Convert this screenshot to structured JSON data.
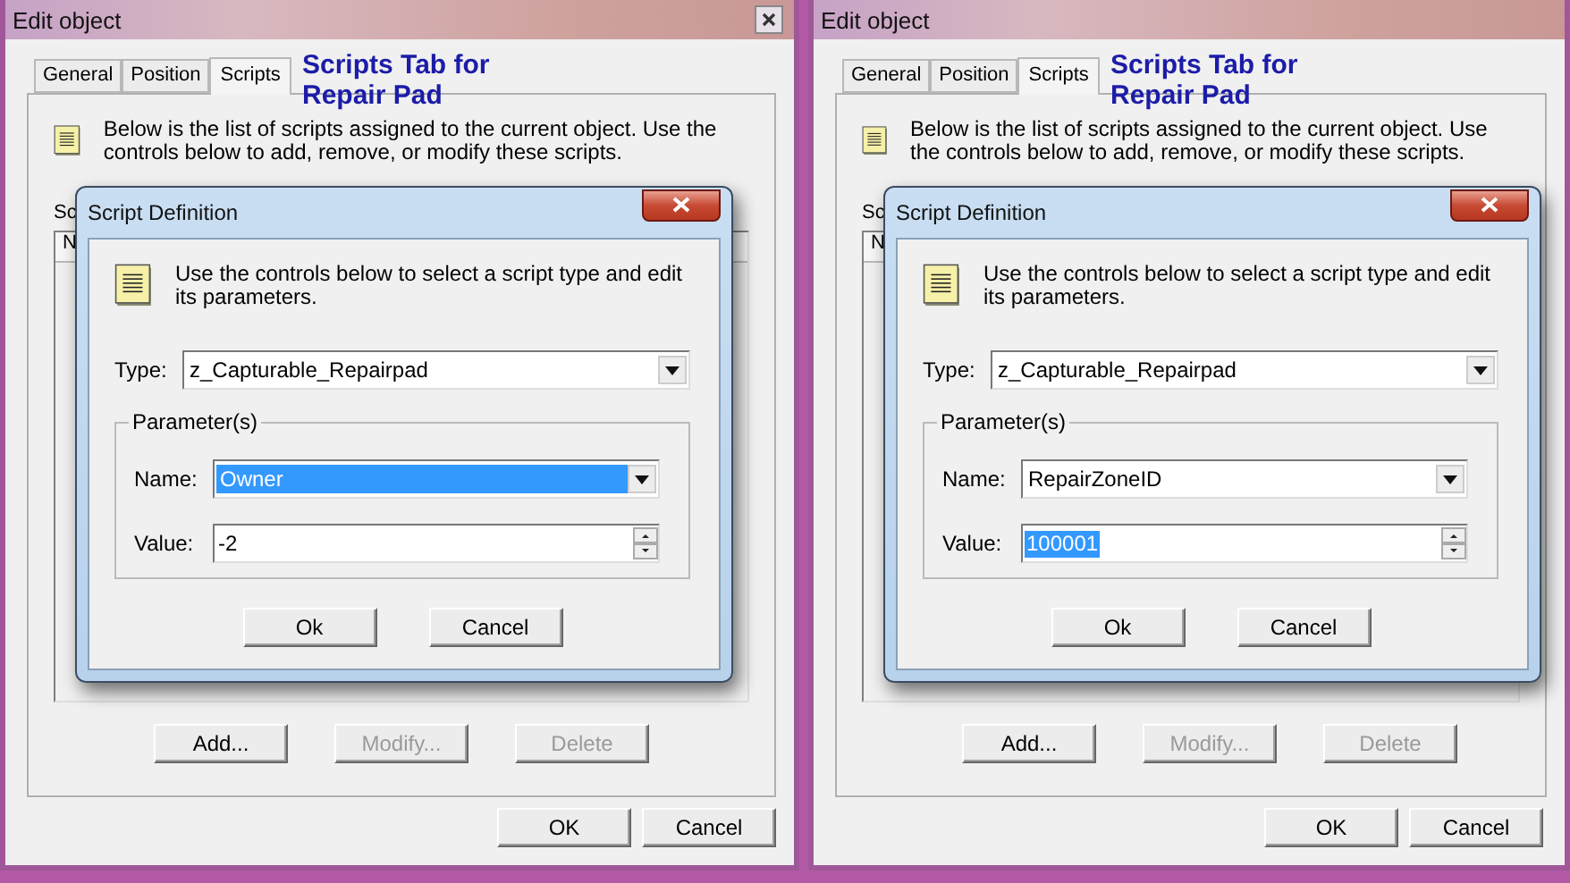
{
  "windows": [
    {
      "title": "Edit object",
      "close_button": true,
      "tabs": [
        {
          "label": "General",
          "selected": false
        },
        {
          "label": "Position",
          "selected": false
        },
        {
          "label": "Scripts",
          "selected": true
        }
      ],
      "annotation": "Scripts Tab for Repair Pad",
      "description": "Below is the list of scripts assigned to the current object.  Use the controls below to add, remove, or modify these scripts.",
      "list_label": "Sc",
      "list_column": "N",
      "buttons": [
        {
          "label": "Add...",
          "disabled": false
        },
        {
          "label": "Modify...",
          "disabled": true
        },
        {
          "label": "Delete",
          "disabled": true
        }
      ],
      "footer_buttons": [
        "OK",
        "Cancel"
      ],
      "dialog": {
        "title": "Script Definition",
        "description": "Use the controls below to select a script type and edit its parameters.",
        "type_label": "Type:",
        "type_value": "z_Capturable_Repairpad",
        "group_label": "Parameter(s)",
        "name_label": "Name:",
        "name_value": "Owner",
        "name_selected": true,
        "value_label": "Value:",
        "value": "-2",
        "value_selected": false,
        "buttons": [
          "Ok",
          "Cancel"
        ]
      }
    },
    {
      "title": "Edit object",
      "close_button": false,
      "tabs": [
        {
          "label": "General",
          "selected": false
        },
        {
          "label": "Position",
          "selected": false
        },
        {
          "label": "Scripts",
          "selected": true
        }
      ],
      "annotation": "Scripts Tab for Repair Pad",
      "description": "Below is the list of scripts assigned to the current object.  Use the controls below to add, remove, or modify these scripts.",
      "list_label": "Sc",
      "list_column": "N",
      "buttons": [
        {
          "label": "Add...",
          "disabled": false
        },
        {
          "label": "Modify...",
          "disabled": true
        },
        {
          "label": "Delete",
          "disabled": true
        }
      ],
      "footer_buttons": [
        "OK",
        "Cancel"
      ],
      "dialog": {
        "title": "Script Definition",
        "description": "Use the controls below to select a script type and edit its parameters.",
        "type_label": "Type:",
        "type_value": "z_Capturable_Repairpad",
        "group_label": "Parameter(s)",
        "name_label": "Name:",
        "name_value": "RepairZoneID",
        "name_selected": false,
        "value_label": "Value:",
        "value": "100001",
        "value_selected": true,
        "buttons": [
          "Ok",
          "Cancel"
        ]
      }
    }
  ]
}
